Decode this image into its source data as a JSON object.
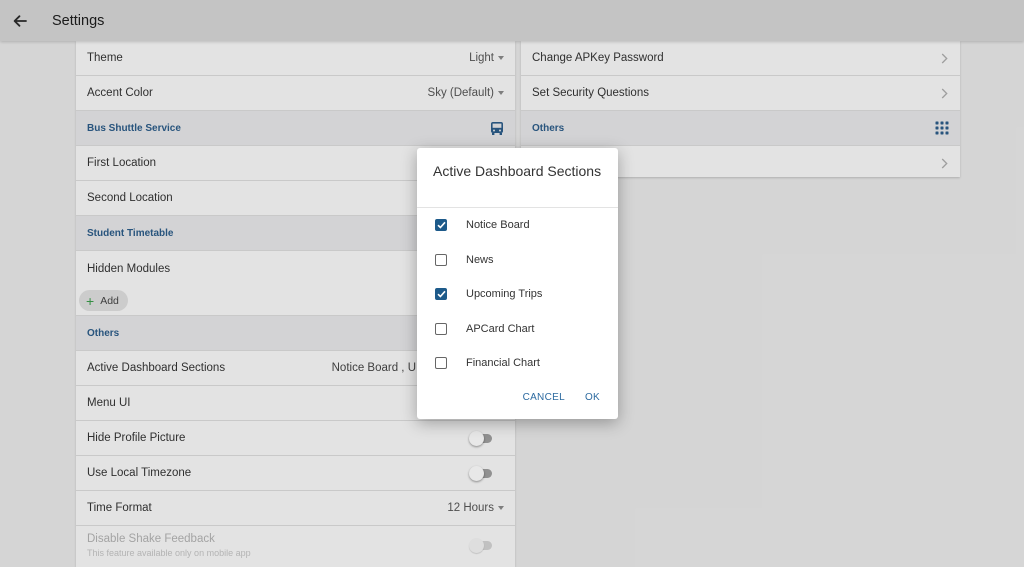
{
  "header": {
    "title": "Settings"
  },
  "left": {
    "theme": {
      "label": "Theme",
      "value": "Light"
    },
    "accent": {
      "label": "Accent Color",
      "value": "Sky (Default)"
    },
    "bus_section": {
      "title": "Bus Shuttle Service"
    },
    "first_location": {
      "label": "First Location"
    },
    "second_location": {
      "label": "Second Location"
    },
    "timetable_section": {
      "title": "Student Timetable"
    },
    "hidden_modules": {
      "label": "Hidden Modules",
      "add_label": "Add"
    },
    "others_section": {
      "title": "Others"
    },
    "active_dashboard": {
      "label": "Active Dashboard Sections",
      "value": "Notice Board , U"
    },
    "menu_ui": {
      "label": "Menu UI"
    },
    "hide_profile": {
      "label": "Hide Profile Picture"
    },
    "local_timezone": {
      "label": "Use Local Timezone"
    },
    "time_format": {
      "label": "Time Format",
      "value": "12 Hours"
    },
    "shake_feedback": {
      "label": "Disable Shake Feedback",
      "sub": "This feature available only on mobile app"
    }
  },
  "right": {
    "change_password": {
      "label": "Change APKey Password"
    },
    "security_questions": {
      "label": "Set Security Questions"
    },
    "others_section": {
      "title": "Others"
    }
  },
  "dialog": {
    "title": "Active Dashboard Sections",
    "options": [
      {
        "label": "Notice Board",
        "checked": true
      },
      {
        "label": "News",
        "checked": false
      },
      {
        "label": "Upcoming Trips",
        "checked": true
      },
      {
        "label": "APCard Chart",
        "checked": false
      },
      {
        "label": "Financial Chart",
        "checked": false
      }
    ],
    "cancel_label": "CANCEL",
    "ok_label": "OK"
  },
  "colors": {
    "accent": "#2c5b87",
    "checkbox": "#1d5a8a",
    "section_bg": "#e3e4e6"
  }
}
